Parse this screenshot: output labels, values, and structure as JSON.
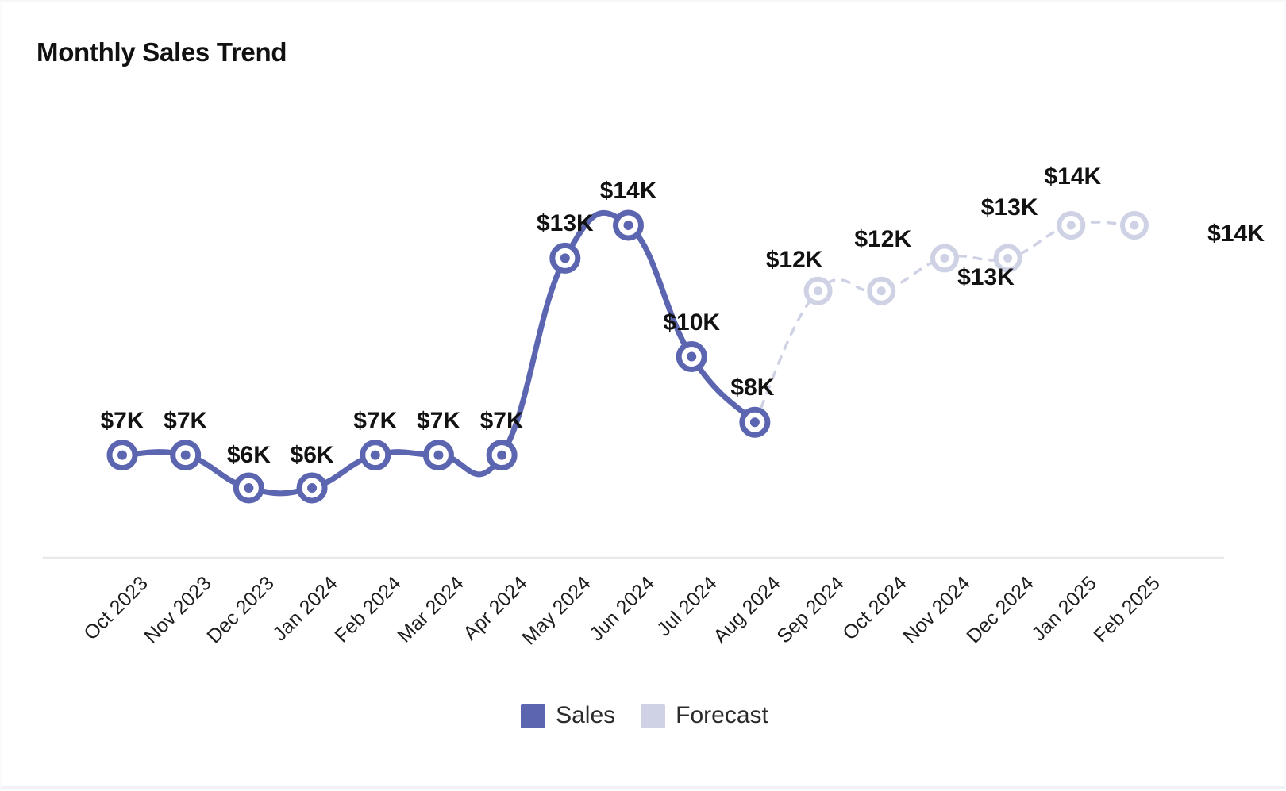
{
  "chart_data": {
    "type": "line",
    "title": "Monthly Sales Trend",
    "xlabel": "",
    "ylabel": "",
    "grid": false,
    "legend_position": "bottom-center",
    "axis_line_color": "#e8e8ec",
    "value_label_format": "$<value>K",
    "ylim": [
      0,
      15
    ],
    "categories": [
      "Oct 2023",
      "Nov 2023",
      "Dec 2023",
      "Jan 2024",
      "Feb 2024",
      "Mar 2024",
      "Apr 2024",
      "May 2024",
      "Jun 2024",
      "Jul 2024",
      "Aug 2024",
      "Sep 2024",
      "Oct 2024",
      "Nov 2024",
      "Dec 2024",
      "Jan 2025",
      "Feb 2025"
    ],
    "series": [
      {
        "name": "Sales",
        "color": "#5b65b0",
        "style": "solid",
        "values": [
          7,
          7,
          6,
          6,
          7,
          7,
          7,
          13,
          14,
          10,
          8,
          null,
          null,
          null,
          null,
          null,
          null
        ],
        "labels": [
          "$7K",
          "$7K",
          "$6K",
          "$6K",
          "$7K",
          "$7K",
          "$7K",
          "$13K",
          "$14K",
          "$10K",
          "$8K",
          "",
          "",
          "",
          "",
          "",
          ""
        ]
      },
      {
        "name": "Forecast",
        "color": "#ced2e4",
        "style": "dotted",
        "values": [
          null,
          null,
          null,
          null,
          null,
          null,
          null,
          null,
          null,
          null,
          8,
          12,
          12,
          13,
          13,
          14,
          14
        ],
        "labels": [
          "",
          "",
          "",
          "",
          "",
          "",
          "",
          "",
          "",
          "",
          "",
          "$12K",
          "$12K",
          "$13K",
          "$13K",
          "$14K",
          "$14K"
        ]
      }
    ],
    "legend": [
      {
        "label": "Sales",
        "color": "#5b65b0"
      },
      {
        "label": "Forecast",
        "color": "#ced2e4"
      }
    ]
  },
  "chart": {
    "title": "Monthly Sales Trend"
  }
}
